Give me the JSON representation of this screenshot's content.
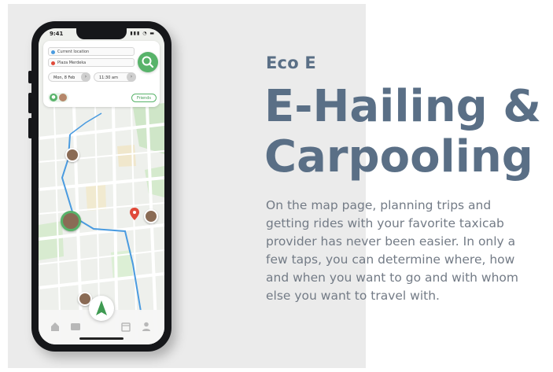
{
  "slide": {
    "eyebrow": "Eco E",
    "headline_line1": "E-Hailing &",
    "headline_line2": "Carpooling",
    "body": "On the map page, planning trips and getting rides with your favorite taxicab provider has never been easier. In only a few taps, you can determine where, how and when you want to go and with whom else you want to travel with."
  },
  "phone": {
    "status_time": "9:41",
    "status_icons": "▮▮▮ ◔ ▬",
    "origin_field": "Current location",
    "destination_field": "Plaza Merdeka",
    "date_pill": "Mon, 8 Feb",
    "time_pill": "11:30 am",
    "friends_button": "Friends",
    "colors": {
      "accent": "#58b36a",
      "destination_pin": "#e04a3a",
      "route": "#4a9be0",
      "text_primary": "#5a6f86",
      "text_body": "#737b86"
    },
    "icons": {
      "search": "search-icon",
      "navigate": "navigation-arrow-icon",
      "home": "home-icon",
      "media": "media-icon",
      "calendar": "calendar-icon",
      "profile": "profile-icon",
      "chevron": "chevron-right-icon",
      "people": "people-icon"
    }
  }
}
